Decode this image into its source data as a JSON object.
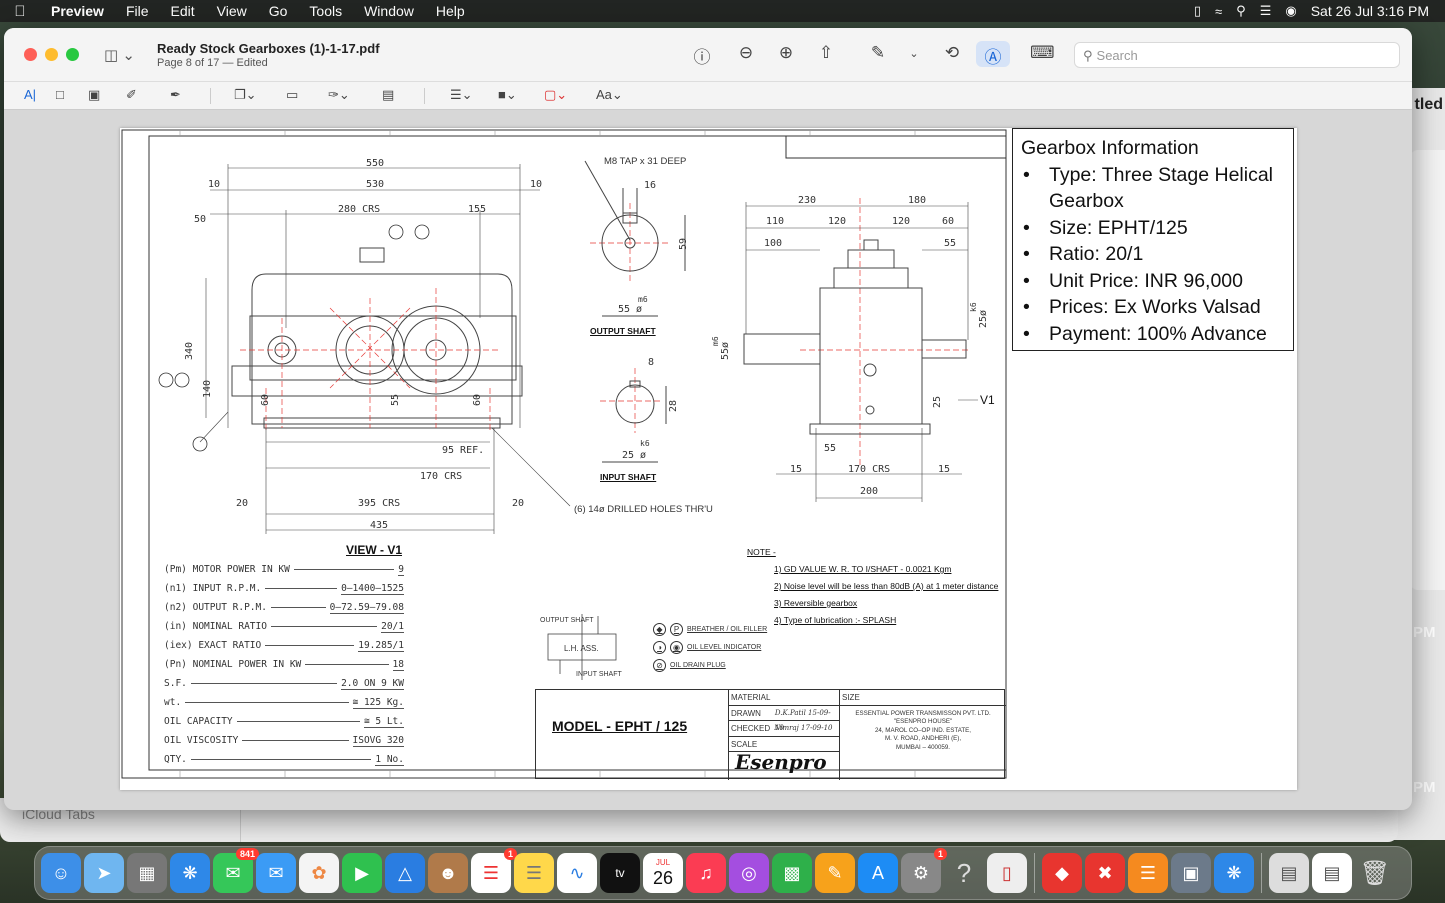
{
  "menubar": {
    "app": "Preview",
    "items": [
      "File",
      "Edit",
      "View",
      "Go",
      "Tools",
      "Window",
      "Help"
    ],
    "datetime": "Sat 26 Jul  3:16 PM"
  },
  "window": {
    "doc_title": "Ready Stock Gearboxes (1)-1-17.pdf",
    "doc_subtitle": "Page 8 of 17 — Edited",
    "search_placeholder": "Search",
    "font_menu": "Aa"
  },
  "background": {
    "partial_title": "tled",
    "pm_labels": [
      "PM",
      "PM"
    ],
    "icloud": "iCloud Tabs"
  },
  "drawing": {
    "view_label": "VIEW - V1",
    "output_shaft_label": "OUTPUT  SHAFT",
    "input_shaft_label": "INPUT  SHAFT",
    "v1_arrow": "V1",
    "tap_note": "M8  TAP  x  31  DEEP",
    "holes_note": "(6)  14ø  DRILLED  HOLES  THR'U",
    "dims_front": [
      "550",
      "530",
      "10",
      "10",
      "280  CRS",
      "155",
      "50",
      "340",
      "140",
      "60",
      "55",
      "60",
      "95  REF.",
      "170  CRS",
      "20",
      "395  CRS",
      "20",
      "435"
    ],
    "dims_output": [
      "16",
      "59",
      "55  ø",
      "m6"
    ],
    "dims_input": [
      "8",
      "28",
      "25  ø",
      "k6"
    ],
    "dims_side": [
      "230",
      "180",
      "110",
      "120",
      "120",
      "60",
      "100",
      "55",
      "k6",
      "25ø",
      "m6",
      "55ø",
      "25",
      "55",
      "15",
      "170  CRS",
      "15",
      "200"
    ],
    "specs": [
      {
        "k": "(Pm) MOTOR POWER IN KW",
        "v": "9"
      },
      {
        "k": "(n1) INPUT R.P.M.",
        "v": "0–1400–1525"
      },
      {
        "k": "(n2) OUTPUT R.P.M.",
        "v": "0–72.59–79.08"
      },
      {
        "k": "(in) NOMINAL RATIO",
        "v": "20/1"
      },
      {
        "k": "(iex) EXACT RATIO",
        "v": "19.285/1"
      },
      {
        "k": "(Pn) NOMINAL POWER IN KW",
        "v": "18"
      },
      {
        "k": "S.F.",
        "v": "2.0 ON 9 KW"
      },
      {
        "k": "wt.",
        "v": "≅ 125 Kg."
      },
      {
        "k": "OIL CAPACITY",
        "v": "≅ 5 Lt."
      },
      {
        "k": "OIL VISCOSITY",
        "v": "ISOVG 320"
      },
      {
        "k": "QTY.",
        "v": "1 No."
      }
    ],
    "notes_title": "NOTE -",
    "notes": [
      "1)  GD  VALUE W. R. TO I/SHAFT - 0.0021 Kgm",
      "2)  Noise level will be less than 80dB (A) at 1 meter distance",
      "3)  Reversible  gearbox",
      "4)  Type  of  lubrication :- SPLASH"
    ],
    "legend": [
      "BREATHER / OIL FILLER",
      "OIL LEVEL INDICATOR",
      "OIL DRAIN PLUG"
    ],
    "assembly": {
      "output": "OUTPUT SHAFT",
      "lh": "L.H. ASS.",
      "input": "INPUT SHAFT"
    },
    "title_block": {
      "model": "MODEL - EPHT / 125",
      "material": "MATERIAL",
      "drawn": "DRAWN",
      "drawn_sig": "D.K.Patil  15-09-10",
      "checked": "CHECKED",
      "checked_sig": "Nimraj  17-09-10",
      "scale": "SCALE",
      "size": "SIZE",
      "logo": "Esenpro",
      "company": [
        "ESSENTIAL  POWER  TRANSMISSON  PVT.  LTD.",
        "\"ESENPRO  HOUSE\"",
        "24,  MAROL  CO–OP  IND.  ESTATE,",
        "M.  V.  ROAD,  ANDHERI  (E),",
        "MUMBAI  –  400059."
      ]
    }
  },
  "info_box": {
    "title": "Gearbox Information",
    "items": [
      "Type: Three Stage Helical Gearbox",
      "Size: EPHT/125",
      "Ratio: 20/1",
      "Unit Price: INR 96,000",
      "Prices: Ex Works Valsad",
      "Payment: 100% Advance"
    ]
  },
  "dock": {
    "badges": {
      "messages": "841",
      "reminders": "1",
      "settings": "1"
    },
    "calendar_month": "JUL",
    "calendar_day": "26"
  },
  "colors": {
    "accent": "#1a66d6",
    "centerline": "#e53935"
  }
}
